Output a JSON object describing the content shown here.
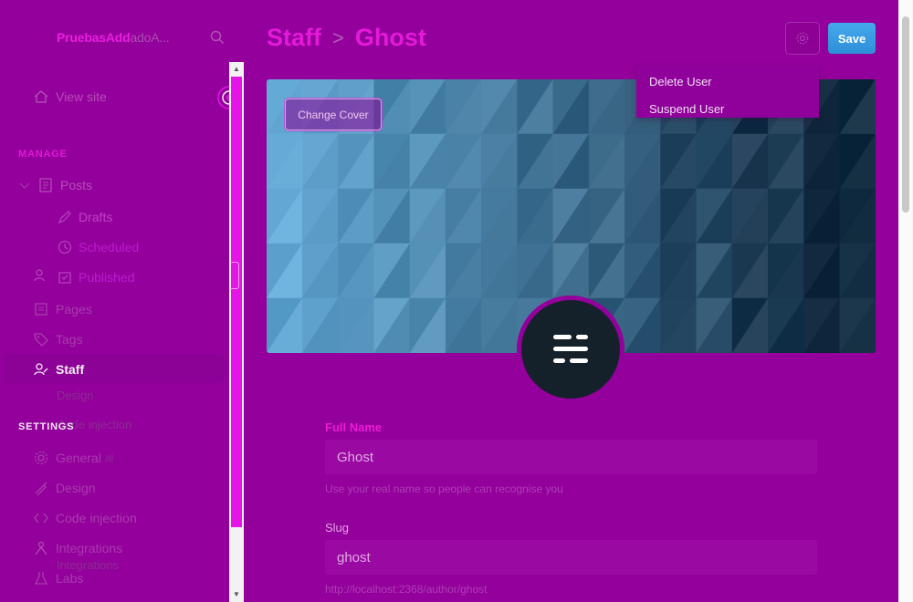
{
  "sidebar": {
    "brand": "PruebasAdd",
    "brand_ghost": "adoA...",
    "view_site": "View site",
    "manage_heading": "MANAGE",
    "posts": "Posts",
    "drafts": "Drafts",
    "scheduled": "Scheduled",
    "published": "Published",
    "pages": "Pages",
    "tags": "Tags",
    "staff": "Staff",
    "settings_heading": "SETTINGS",
    "general": "General",
    "design": "Design",
    "code_injection": "Code injection",
    "integrations": "Integrations",
    "labs": "Labs",
    "ghost_labels": {
      "pages_shadow": "Pages",
      "tags_shadow": "Tags",
      "design_shadow": "Design",
      "code_shadow": "Code injection",
      "general_shadow": "al",
      "integrations_shadow": "Integrations"
    }
  },
  "header": {
    "section": "Staff",
    "separator": ">",
    "name": "Ghost",
    "save_label": "Save"
  },
  "cover": {
    "change_label": "Change Cover"
  },
  "menu": {
    "delete_user": "Delete User",
    "suspend_user": "Suspend User"
  },
  "form": {
    "full_name_label": "Full Name",
    "full_name_value": "Ghost",
    "full_name_hint": "Use your real name so people can recognise you",
    "slug_label": "Slug",
    "slug_value": "ghost",
    "slug_hint": "http://localhost:2368/author/ghost"
  },
  "colors": {
    "background": "#94009b",
    "accent": "#e419d9",
    "save": "#3a9fe6",
    "avatar": "#15212a"
  }
}
